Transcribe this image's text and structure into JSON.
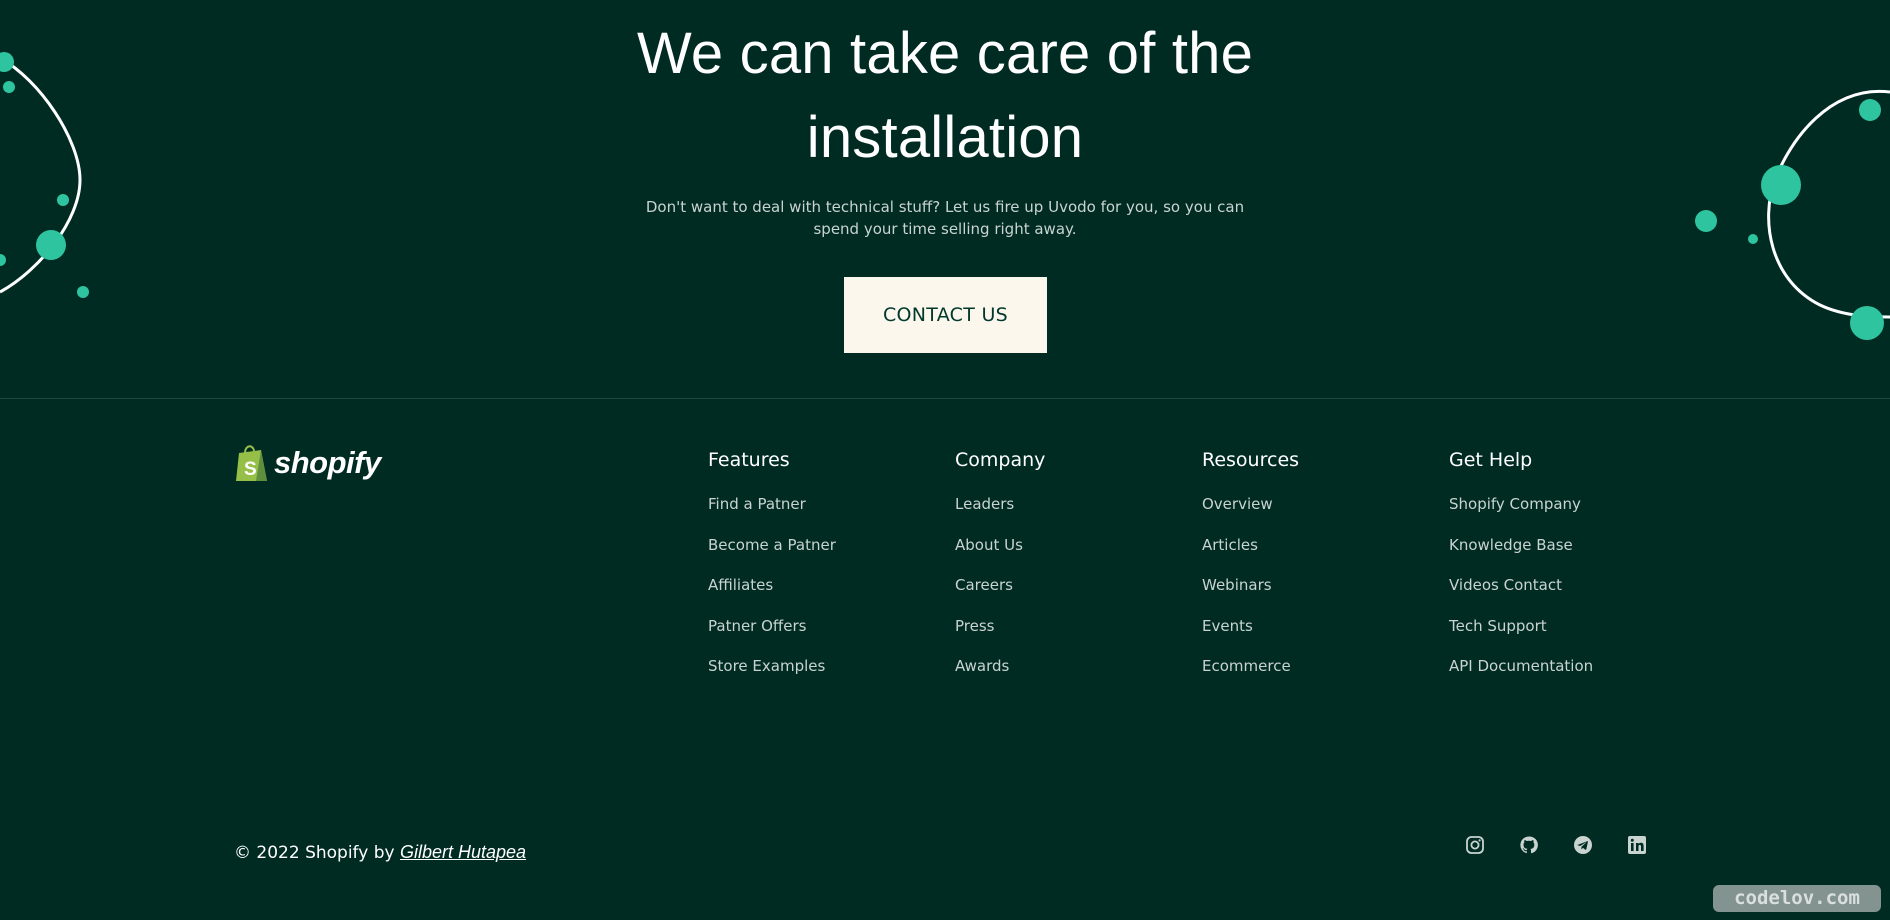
{
  "hero": {
    "title_line1": "We can take care of the",
    "title_line2": "installation",
    "description_line1": "Don't want to deal with technical stuff? Let us fire up Uvodo for you, so you can",
    "description_line2": "spend your time selling right away.",
    "cta_label": "CONTACT US"
  },
  "brand": {
    "logo_text": "shopify",
    "logo_icon": "shopify-bag-icon"
  },
  "footer": {
    "columns": [
      {
        "title": "Features",
        "links": [
          "Find a Patner",
          "Become a Patner",
          "Affiliates",
          "Patner Offers",
          "Store Examples"
        ]
      },
      {
        "title": "Company",
        "links": [
          "Leaders",
          "About Us",
          "Careers",
          "Press",
          "Awards"
        ]
      },
      {
        "title": "Resources",
        "links": [
          "Overview",
          "Articles",
          "Webinars",
          "Events",
          "Ecommerce"
        ]
      },
      {
        "title": "Get Help",
        "links": [
          "Shopify Company",
          "Knowledge Base",
          "Videos Contact",
          "Tech Support",
          "API Documentation"
        ]
      }
    ],
    "copyright_prefix": "© 2022 Shopify by",
    "author": "Gilbert Hutapea",
    "socials": [
      "instagram-icon",
      "github-icon",
      "telegram-icon",
      "linkedin-icon"
    ]
  },
  "watermark": "codelov.com",
  "colors": {
    "background": "#002b23",
    "accent": "#2ec4a0",
    "button_bg": "#fbf7ed",
    "button_text": "#00382c",
    "muted_text": "#c9d3cf"
  }
}
